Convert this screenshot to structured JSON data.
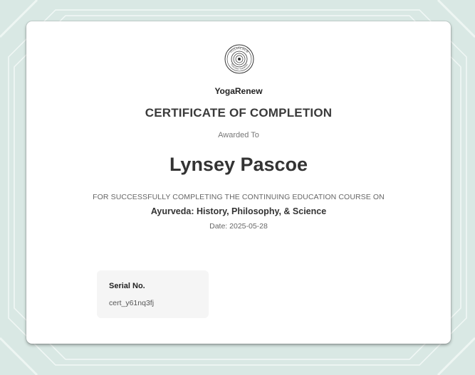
{
  "certificate": {
    "brand": "YogaRenew",
    "title": "CERTIFICATE OF COMPLETION",
    "awarded_label": "Awarded To",
    "recipient": "Lynsey Pascoe",
    "course_intro": "FOR SUCCESSFULLY COMPLETING THE CONTINUING EDUCATION COURSE ON",
    "course_name": "Ayurveda: History, Philosophy, & Science",
    "date": "Date: 2025-05-28",
    "serial_label": "Serial No.",
    "serial_value": "cert_y61nq3fj"
  },
  "seal": {
    "icon": "yogarenew-seal-icon",
    "text_top": "YOGARENEW",
    "text_bottom": "TEACHER TRAINING"
  },
  "colors": {
    "background": "#d9e8e4",
    "card": "#ffffff",
    "serial_box": "#f5f5f5"
  }
}
